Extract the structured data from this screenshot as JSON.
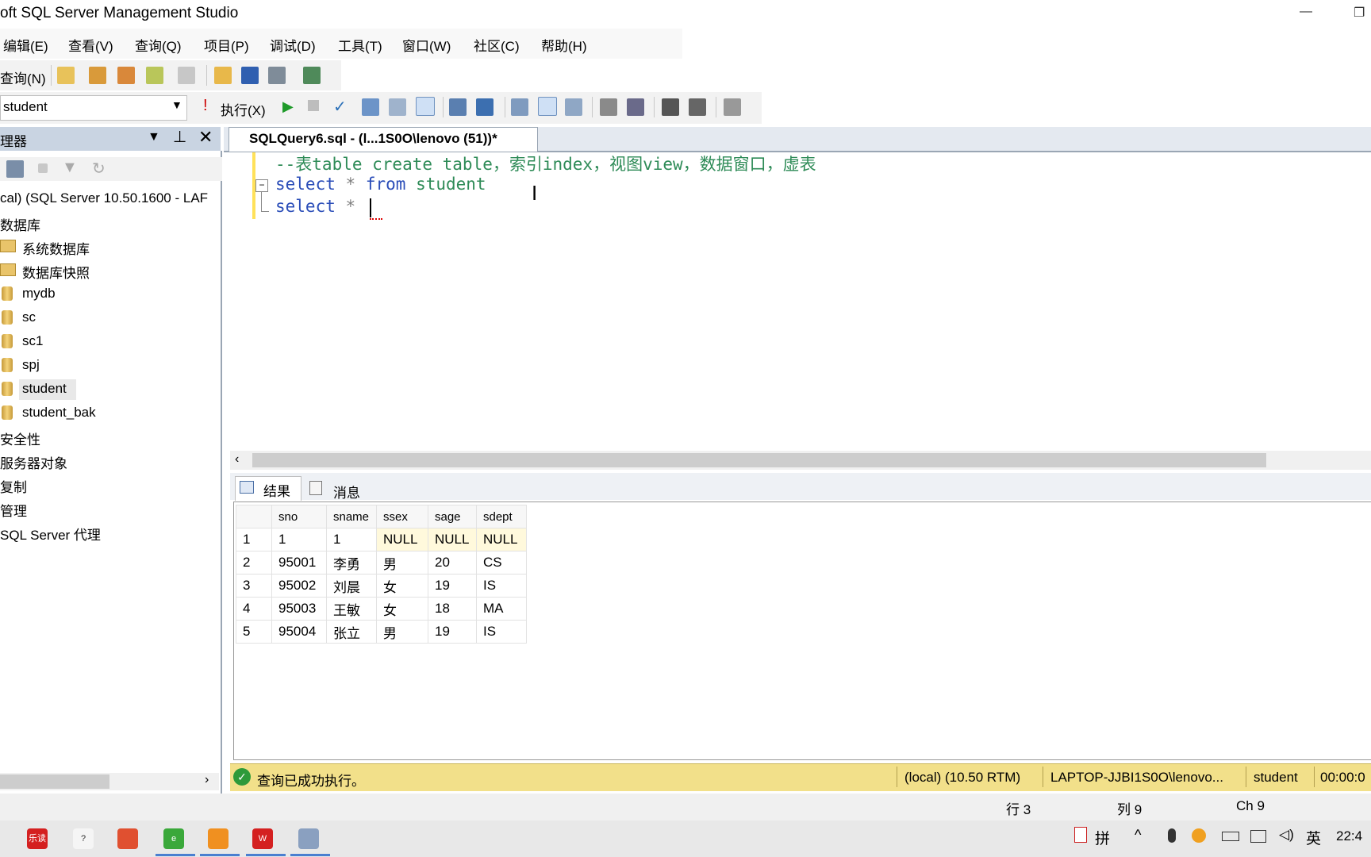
{
  "window": {
    "title": "oft SQL Server Management Studio",
    "minimize": "—",
    "restore": "❐"
  },
  "menu": [
    "编辑(E)",
    "查看(V)",
    "查询(Q)",
    "项目(P)",
    "调试(D)",
    "工具(T)",
    "窗口(W)",
    "社区(C)",
    "帮助(H)"
  ],
  "toolbar1": {
    "new_query": "查询(N)"
  },
  "toolbar2": {
    "database": "student",
    "execute": "执行(X)"
  },
  "object_explorer": {
    "title": "理器",
    "server": "cal) (SQL Server 10.50.1600 - LAF",
    "items": [
      {
        "label": "数据库"
      },
      {
        "label": "系统数据库"
      },
      {
        "label": "数据库快照"
      },
      {
        "label": "mydb"
      },
      {
        "label": "sc"
      },
      {
        "label": "sc1"
      },
      {
        "label": "spj"
      },
      {
        "label": "student"
      },
      {
        "label": "student_bak"
      },
      {
        "label": "安全性"
      },
      {
        "label": "服务器对象"
      },
      {
        "label": "复制"
      },
      {
        "label": "管理"
      },
      {
        "label": "SQL Server 代理"
      }
    ]
  },
  "editor": {
    "tab_title": "SQLQuery6.sql - (l...1S0O\\lenovo (51))*",
    "line1": "--表table create table，索引index，视图view，数据窗口，虚表",
    "line2_kw": "select",
    "line2_star": "*",
    "line2_from": "from",
    "line2_table": "student",
    "line3_kw": "select",
    "line3_star": "*"
  },
  "results": {
    "tab_results": "结果",
    "tab_messages": "消息",
    "columns": [
      "sno",
      "sname",
      "ssex",
      "sage",
      "sdept"
    ],
    "rows": [
      [
        "1",
        "1",
        "1",
        "NULL",
        "NULL",
        "NULL"
      ],
      [
        "2",
        "95001",
        "李勇",
        "男",
        "20",
        "CS"
      ],
      [
        "3",
        "95002",
        "刘晨",
        "女",
        "19",
        "IS"
      ],
      [
        "4",
        "95003",
        "王敏",
        "女",
        "18",
        "MA"
      ],
      [
        "5",
        "95004",
        "张立",
        "男",
        "19",
        "IS"
      ]
    ]
  },
  "status": {
    "message": "查询已成功执行。",
    "server": "(local) (10.50 RTM)",
    "login": "LAPTOP-JJBI1S0O\\lenovo...",
    "database": "student",
    "elapsed": "00:00:0"
  },
  "position": {
    "line": "行 3",
    "col": "列 9",
    "ch": "Ch 9"
  },
  "taskbar": {
    "ime": "拼",
    "lang": "英",
    "clock": "22:4",
    "app1": "乐读"
  },
  "colors": {
    "accent": "#2a4db8",
    "status_bg": "#f2e08a",
    "comment": "#2e8b57"
  }
}
